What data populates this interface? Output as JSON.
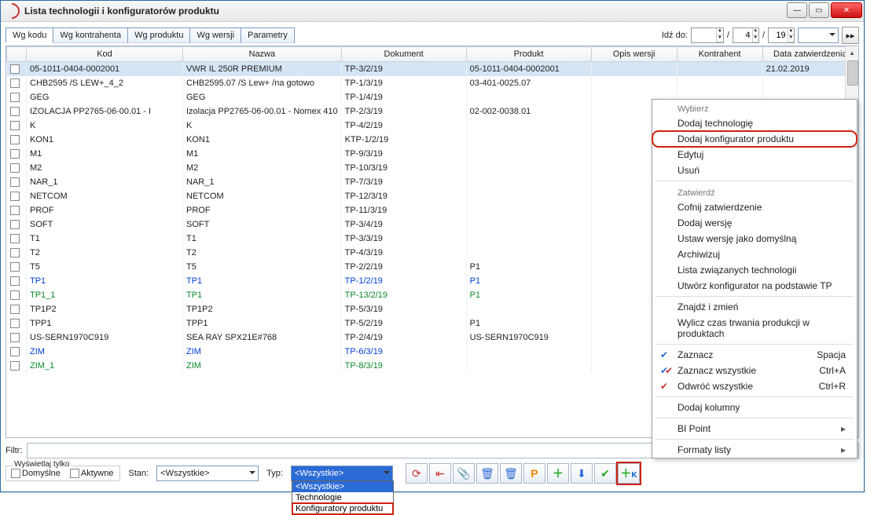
{
  "window": {
    "title": "Lista technologii i konfiguratorów produktu"
  },
  "tabs": [
    "Wg kodu",
    "Wg kontrahenta",
    "Wg produktu",
    "Wg wersji",
    "Parametry"
  ],
  "goto": {
    "label": "Idź do:",
    "v1": "",
    "v2": "4",
    "v3": "19"
  },
  "columns": [
    "Kod",
    "Nazwa",
    "Dokument",
    "Produkt",
    "Opis wersji",
    "Kontrahent",
    "Data zatwierdzenia"
  ],
  "rows": [
    {
      "kod": "05-1011-0404-0002001",
      "nazwa": "VWR IL 250R PREMIUM",
      "dok": "TP-3/2/19",
      "prod": "05-1011-0404-0002001",
      "data": "21.02.2019",
      "cls": "sel-row"
    },
    {
      "kod": "CHB2595 /S LEW+_4_2",
      "nazwa": "CHB2595.07 /S Lew+ /na gotowo",
      "dok": "TP-1/3/19",
      "prod": "03-401-0025.07"
    },
    {
      "kod": "GEG",
      "nazwa": "GEG",
      "dok": "TP-1/4/19"
    },
    {
      "kod": "IZOLACJA PP2765-06-00.01 - I",
      "nazwa": "Izolacja PP2765-06-00.01 - Nomex 410",
      "dok": "TP-2/3/19",
      "prod": "02-002-0038.01"
    },
    {
      "kod": "K",
      "nazwa": "K",
      "dok": "TP-4/2/19"
    },
    {
      "kod": "KON1",
      "nazwa": "KON1",
      "dok": "KTP-1/2/19"
    },
    {
      "kod": "M1",
      "nazwa": "M1",
      "dok": "TP-9/3/19"
    },
    {
      "kod": "M2",
      "nazwa": "M2",
      "dok": "TP-10/3/19"
    },
    {
      "kod": "NAR_1",
      "nazwa": "NAR_1",
      "dok": "TP-7/3/19"
    },
    {
      "kod": "NETCOM",
      "nazwa": "NETCOM",
      "dok": "TP-12/3/19"
    },
    {
      "kod": "PROF",
      "nazwa": "PROF",
      "dok": "TP-11/3/19"
    },
    {
      "kod": "SOFT",
      "nazwa": "SOFT",
      "dok": "TP-3/4/19"
    },
    {
      "kod": "T1",
      "nazwa": "T1",
      "dok": "TP-3/3/19"
    },
    {
      "kod": "T2",
      "nazwa": "T2",
      "dok": "TP-4/3/19"
    },
    {
      "kod": "T5",
      "nazwa": "T5",
      "dok": "TP-2/2/19",
      "prod": "P1"
    },
    {
      "kod": "TP1",
      "nazwa": "TP1",
      "dok": "TP-1/2/19",
      "prod": "P1",
      "cls": "blue"
    },
    {
      "kod": "TP1_1",
      "nazwa": "TP1",
      "dok": "TP-13/2/19",
      "prod": "P1",
      "cls": "green"
    },
    {
      "kod": "TP1P2",
      "nazwa": "TP1P2",
      "dok": "TP-5/3/19"
    },
    {
      "kod": "TPP1",
      "nazwa": "TPP1",
      "dok": "TP-5/2/19",
      "prod": "P1"
    },
    {
      "kod": "US-SERN1970C919",
      "nazwa": "SEA RAY SPX21E#768",
      "dok": "TP-2/4/19",
      "prod": "US-SERN1970C919"
    },
    {
      "kod": "ZIM",
      "nazwa": "ZIM",
      "dok": "TP-6/3/19",
      "cls": "blue"
    },
    {
      "kod": "ZIM_1",
      "nazwa": "ZIM",
      "dok": "TP-8/3/19",
      "cls": "green"
    }
  ],
  "filter": {
    "label": "Filtr:"
  },
  "display": {
    "legend": "Wyświetlaj tylko",
    "chk1": "Domyślne",
    "chk2": "Aktywne",
    "stan_label": "Stan:",
    "stan_val": "<Wszystkie>",
    "typ_label": "Typ:",
    "typ_val": "<Wszystkie>",
    "typ_options": [
      "<Wszystkie>",
      "Technologie",
      "Konfiguratory produktu"
    ]
  },
  "ctx": {
    "sec1": "Wybierz",
    "items1": [
      "Dodaj technologię",
      "Dodaj konfigurator produktu",
      "Edytuj",
      "Usuń"
    ],
    "sec2": "Zatwierdź",
    "items2": [
      "Cofnij zatwierdzenie",
      "Dodaj wersję",
      "Ustaw wersję jako domyślną",
      "Archiwizuj",
      "Lista związanych technologii",
      "Utwórz konfigurator na podstawie TP"
    ],
    "items3": [
      "Znajdź i zmień",
      "Wylicz czas trwania produkcji w produktach"
    ],
    "check_items": [
      {
        "icon": "✔",
        "label": "Zaznacz",
        "short": "Spacja"
      },
      {
        "icon": "✔✔",
        "label": "Zaznacz wszystkie",
        "short": "Ctrl+A"
      },
      {
        "icon": "⤾",
        "label": "Odwróć wszystkie",
        "short": "Ctrl+R"
      }
    ],
    "items4": [
      "Dodaj kolumny"
    ],
    "sub_items": [
      "BI Point",
      "Formaty listy"
    ]
  }
}
